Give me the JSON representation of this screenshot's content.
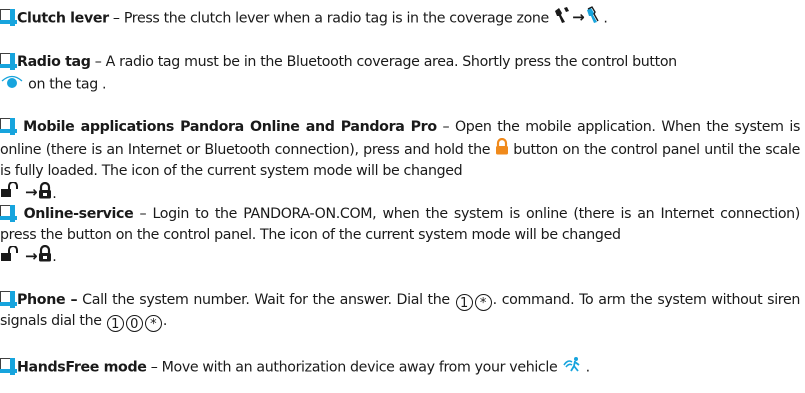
{
  "colors": {
    "accent": "#17a4dd",
    "text": "#1a1a1a",
    "lock_orange": "#f08a1c"
  },
  "icons": [
    "checkbox-icon",
    "clutch-lever-released-icon",
    "clutch-lever-pressed-icon",
    "control-button-icon",
    "lock-open-icon",
    "lock-closed-icon",
    "arrow-right-icon",
    "key-1-icon",
    "key-0-icon",
    "key-star-icon",
    "walking-away-icon"
  ],
  "entries": {
    "clutch": {
      "title": "Clutch lever",
      "text": " – Press the clutch lever when a radio tag is in the coverage zone ",
      "end": "."
    },
    "radio": {
      "title": "Radio tag",
      "text1": " – A radio tag must be in the Bluetooth coverage area. Shortly press the control button ",
      "text2": " on the tag ."
    },
    "mobile": {
      "title": " Mobile applications Pandora Online and Pandora Pro",
      "text1": " – Open the mobile application. When the system is online (there is an Internet or Bluetooth connection), press and hold the ",
      "text2": " button on the control panel until the scale is fully loaded. The icon of the current system mode will be changed ",
      "end": "."
    },
    "online": {
      "title": " Online-service",
      "text": " – Login to the PANDORA-ON.COM, when the system is online (there is an Internet connection) press the button on the control panel. The icon of the current system mode will be changed ",
      "end": "."
    },
    "phone": {
      "title": "Phone –",
      "text1": " Call the system number. Wait for the answer. Dial the ",
      "text2": ". command. To arm the system without siren signals dial the ",
      "end": ".",
      "keys": {
        "one": "1",
        "zero": "0",
        "star": "*"
      }
    },
    "handsfree": {
      "title": "HandsFree mode",
      "text": " – Move with an authorization device away from your vehicle ",
      "end": " ."
    }
  }
}
